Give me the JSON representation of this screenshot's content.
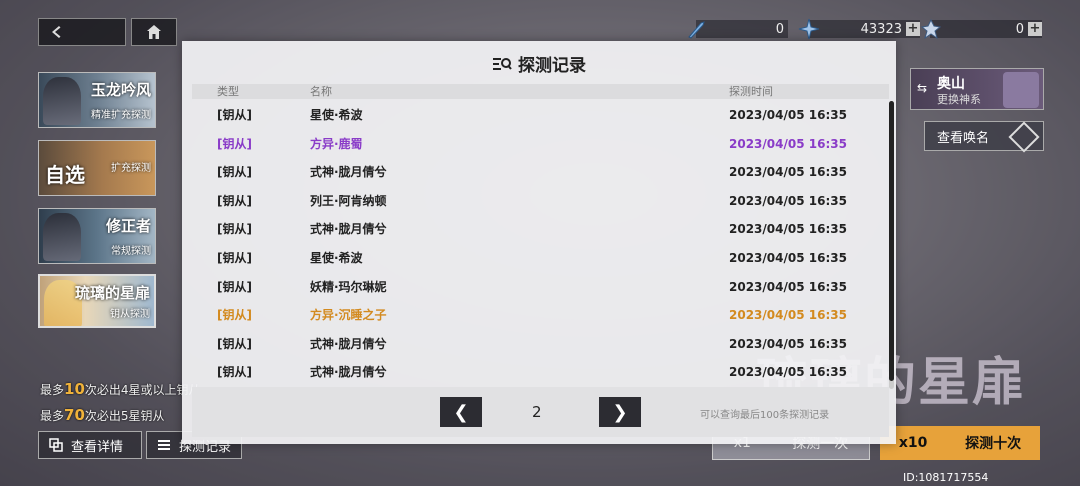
{
  "nav": {
    "back_icon": "chevron-left-icon",
    "home_icon": "home-icon"
  },
  "currency": [
    {
      "icon": "key-icon",
      "value": "0",
      "plus": ""
    },
    {
      "icon": "star-shard-icon",
      "value": "43323",
      "plus": "+"
    },
    {
      "icon": "crystal-icon",
      "value": "0",
      "plus": "+"
    }
  ],
  "banners": [
    {
      "title": "玉龙吟风",
      "subtitle": "精准扩充探测"
    },
    {
      "title": "自选",
      "subtitle": "扩充探测"
    },
    {
      "title": "修正者",
      "subtitle": "常规探测"
    },
    {
      "title": "琉璃的星扉",
      "subtitle": "钥从探测"
    }
  ],
  "rules": {
    "line1_prefix": "最多",
    "line1_num": "10",
    "line1_suffix": "次必出4星或以上钥从",
    "line2_prefix": "最多",
    "line2_num": "70",
    "line2_suffix": "次必出5星钥从"
  },
  "left_buttons": {
    "details": "查看详情",
    "records": "探测记录"
  },
  "right": {
    "god_name": "奥山",
    "god_sub": "更换神系",
    "summon_label": "查看唤名",
    "big_title": "琉璃的星扉",
    "draw1": {
      "count": "x1",
      "label": "探测一次"
    },
    "draw10": {
      "count": "x10",
      "label": "探测十次"
    },
    "uid": "ID:1081717554"
  },
  "modal": {
    "title": "探测记录",
    "columns": {
      "type": "类型",
      "name": "名称",
      "time": "探测时间"
    },
    "rows": [
      {
        "type": "[钥从]",
        "name": "星使·希波",
        "time": "2023/04/05 16:35",
        "rarity": "normal"
      },
      {
        "type": "[钥从]",
        "name": "方异·鹿蜀",
        "time": "2023/04/05 16:35",
        "rarity": "purple"
      },
      {
        "type": "[钥从]",
        "name": "式神·胧月倩兮",
        "time": "2023/04/05 16:35",
        "rarity": "normal"
      },
      {
        "type": "[钥从]",
        "name": "列王·阿肯纳顿",
        "time": "2023/04/05 16:35",
        "rarity": "normal"
      },
      {
        "type": "[钥从]",
        "name": "式神·胧月倩兮",
        "time": "2023/04/05 16:35",
        "rarity": "normal"
      },
      {
        "type": "[钥从]",
        "name": "星使·希波",
        "time": "2023/04/05 16:35",
        "rarity": "normal"
      },
      {
        "type": "[钥从]",
        "name": "妖精·玛尔琳妮",
        "time": "2023/04/05 16:35",
        "rarity": "normal"
      },
      {
        "type": "[钥从]",
        "name": "方异·沉睡之子",
        "time": "2023/04/05 16:35",
        "rarity": "gold"
      },
      {
        "type": "[钥从]",
        "name": "式神·胧月倩兮",
        "time": "2023/04/05 16:35",
        "rarity": "normal"
      },
      {
        "type": "[钥从]",
        "name": "式神·胧月倩兮",
        "time": "2023/04/05 16:35",
        "rarity": "normal"
      }
    ],
    "pagination": {
      "prev": "❮",
      "page": "2",
      "next": "❯"
    },
    "note": "可以查询最后100条探测记录"
  }
}
